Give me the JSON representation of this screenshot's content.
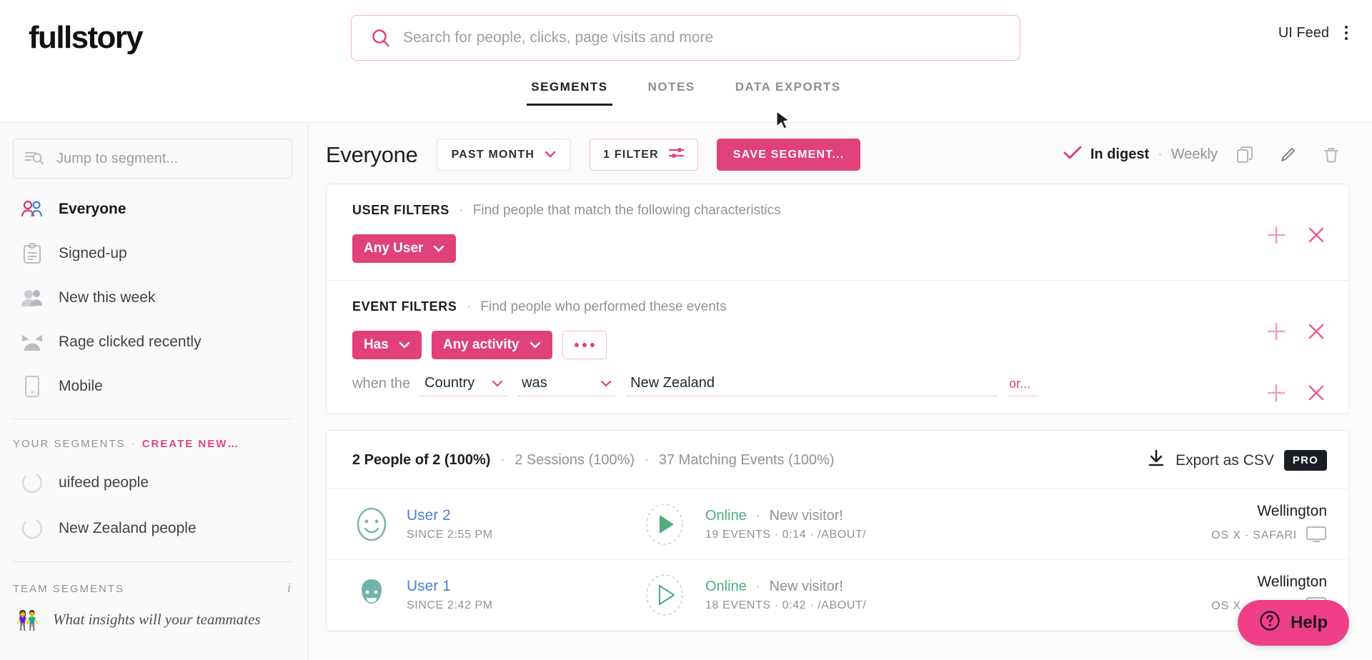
{
  "brand": {
    "logo": "fullstory",
    "accent": "#e0417a"
  },
  "topbar": {
    "search_placeholder": "Search for people, clicks, page visits and more",
    "search_value": "",
    "account_name": "UI Feed",
    "tabs": [
      {
        "label": "SEGMENTS",
        "active": true
      },
      {
        "label": "NOTES",
        "active": false
      },
      {
        "label": "DATA EXPORTS",
        "active": false
      }
    ]
  },
  "sidebar": {
    "jump_placeholder": "Jump to segment...",
    "jump_value": "",
    "items": [
      {
        "label": "Everyone",
        "icon": "people-icon",
        "current": true
      },
      {
        "label": "Signed-up",
        "icon": "clipboard-icon",
        "current": false
      },
      {
        "label": "New this week",
        "icon": "new-people-icon",
        "current": false
      },
      {
        "label": "Rage clicked recently",
        "icon": "rage-face-icon",
        "current": false
      },
      {
        "label": "Mobile",
        "icon": "mobile-icon",
        "current": false
      }
    ],
    "your_segments": {
      "title": "YOUR SEGMENTS",
      "separator": "·",
      "create_new": "CREATE NEW…",
      "items": [
        {
          "label": "uifeed people",
          "icon": "loading-spinner-icon"
        },
        {
          "label": "New Zealand people",
          "icon": "loading-spinner-icon"
        }
      ]
    },
    "team_segments": {
      "title": "TEAM SEGMENTS",
      "info": "i",
      "promo_emoji": "👫",
      "promo_text": "What insights will your teammates"
    }
  },
  "main": {
    "header": {
      "segment_title": "Everyone",
      "date_range": "PAST MONTH",
      "filter_button": "1 FILTER",
      "save_button": "SAVE SEGMENT...",
      "digest_label": "In digest",
      "digest_sep": "·",
      "digest_freq": "Weekly"
    },
    "user_filters": {
      "title": "USER FILTERS",
      "sep": "·",
      "description": "Find people that match the following characteristics",
      "pill": "Any User"
    },
    "event_filters": {
      "title": "EVENT FILTERS",
      "sep": "·",
      "description": "Find people who performed these events",
      "pill_has": "Has",
      "pill_activity": "Any activity",
      "condition_prefix": "when the",
      "condition_field": "Country",
      "condition_operator": "was",
      "condition_value": "New Zealand",
      "or_link": "or..."
    },
    "results": {
      "people": "2 People of 2 (100%)",
      "sep": "·",
      "sessions": "2 Sessions (100%)",
      "events": "37 Matching Events (100%)",
      "export_label": "Export as CSV",
      "pro_badge": "PRO",
      "rows": [
        {
          "name": "User 2",
          "since": "SINCE 2:55 PM",
          "status": "Online",
          "status_sep": "·",
          "visitor": "New visitor!",
          "events": "19 EVENTS · 0:14 · /ABOUT/",
          "city": "Wellington",
          "device": "OS X · SAFARI",
          "avatar_color": "#7bb9a6",
          "play_filled": true
        },
        {
          "name": "User 1",
          "since": "SINCE 2:42 PM",
          "status": "Online",
          "status_sep": "·",
          "visitor": "New visitor!",
          "events": "18 EVENTS · 0:42 · /ABOUT/",
          "city": "Wellington",
          "device": "OS X · SAFARI",
          "avatar_color": "#6fb3ab",
          "play_filled": false
        }
      ]
    }
  },
  "help": {
    "label": "Help"
  }
}
